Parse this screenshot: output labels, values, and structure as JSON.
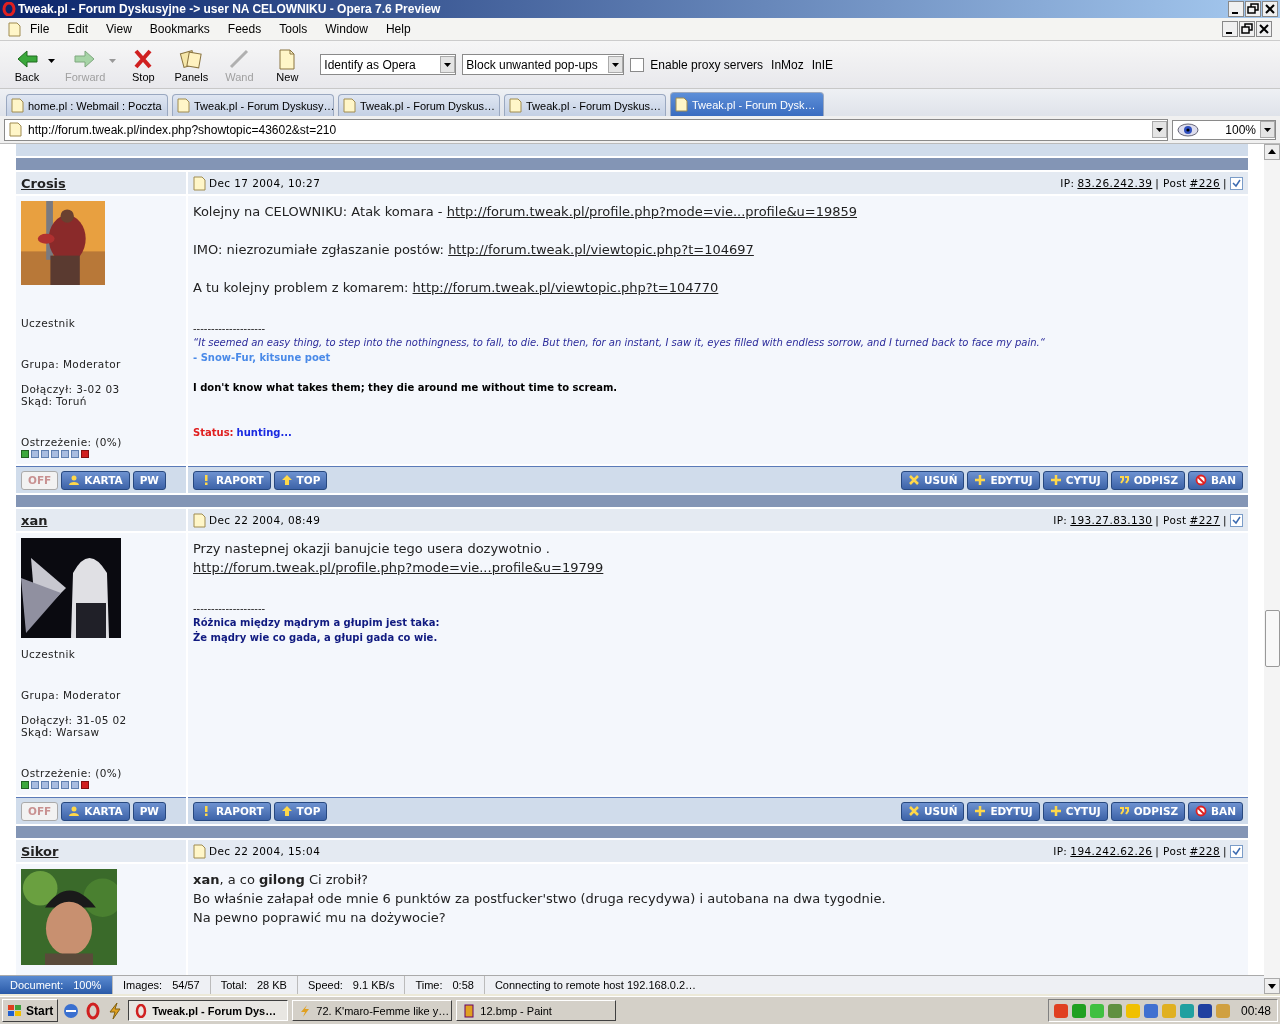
{
  "window": {
    "title": "Tweak.pl - Forum Dyskusyjne -> user NA CELOWNIKU - Opera 7.6 Preview"
  },
  "menu": [
    "File",
    "Edit",
    "View",
    "Bookmarks",
    "Feeds",
    "Tools",
    "Window",
    "Help"
  ],
  "toolbar": {
    "buttons": [
      {
        "label": "Back",
        "disabled": false,
        "caret": true
      },
      {
        "label": "Forward",
        "disabled": true,
        "caret": true
      },
      {
        "label": "Stop",
        "disabled": false,
        "caret": false
      },
      {
        "label": "Panels",
        "disabled": false,
        "caret": false
      },
      {
        "label": "Wand",
        "disabled": true,
        "caret": false
      },
      {
        "label": "New",
        "disabled": false,
        "caret": false
      }
    ],
    "dropdowns": [
      "Identify as Opera",
      "Block unwanted pop-ups"
    ],
    "proxy": {
      "label": "Enable proxy servers",
      "checked": false
    },
    "links": [
      "InMoz",
      "InIE"
    ]
  },
  "tabs": [
    {
      "label": "home.pl : Webmail : Poczta",
      "selected": false
    },
    {
      "label": "Tweak.pl - Forum Dyskusy…",
      "selected": false
    },
    {
      "label": "Tweak.pl - Forum Dyskus…",
      "selected": false
    },
    {
      "label": "Tweak.pl - Forum Dyskus…",
      "selected": false
    },
    {
      "label": "Tweak.pl - Forum Dysk…",
      "selected": true
    }
  ],
  "address": {
    "url": "http://forum.tweak.pl/index.php?showtopic=43602&st=210",
    "zoom": "100%"
  },
  "posts": [
    {
      "author": "Crosis",
      "date": "Dec 17 2004, 10:27",
      "ip_label": "IP:",
      "ip": "83.26.242.39",
      "post_label": "| Post",
      "post_number": "#226",
      "post_end": "|",
      "checked": true,
      "rank": "Uczestnik",
      "group": "Grupa: Moderator",
      "joined": "Dołączył: 3-02 03",
      "from": "Skąd: Toruń",
      "warning": "Ostrzeżenie: (0%)",
      "blocks": [
        {
          "kind": "para",
          "text": "Kolejny na CELOWNIKU: Atak komara - ",
          "link": "http://forum.tweak.pl/profile.php?mode=vie...profile&u=19859"
        },
        {
          "kind": "para",
          "text": "IMO: niezrozumiałe zgłaszanie postów: ",
          "link": "http://forum.tweak.pl/viewtopic.php?t=104697"
        },
        {
          "kind": "para",
          "text": "A tu kolejny problem z komarem: ",
          "link": "http://forum.tweak.pl/viewtopic.php?t=104770"
        },
        {
          "kind": "rule",
          "text": "--------------------"
        },
        {
          "kind": "quote",
          "text": "“It seemed an easy thing, to step into the nothingness, to fall, to die. But then, for an instant, I saw it, eyes filled with endless sorrow, and I turned back to face my pain.“"
        },
        {
          "kind": "attribution",
          "text": "- Snow-Fur, kitsune poet"
        },
        {
          "kind": "motto",
          "text": "I don't know what takes them; they die around me without time to scream."
        },
        {
          "kind": "status",
          "label": "Status:",
          "text": "hunting..."
        }
      ],
      "left_buttons": [
        {
          "label": "OFF",
          "kind": "status"
        },
        {
          "label": "KARTA",
          "kind": "action"
        },
        {
          "label": "PW",
          "kind": "action"
        }
      ],
      "mid_buttons": [
        "RAPORT",
        "TOP"
      ],
      "right_buttons": [
        "USUŃ",
        "EDYTUJ",
        "CYTUJ",
        "ODPISZ",
        "BAN"
      ]
    },
    {
      "author": "xan",
      "date": "Dec 22 2004, 08:49",
      "ip_label": "IP:",
      "ip": "193.27.83.130",
      "post_label": "| Post",
      "post_number": "#227",
      "post_end": "|",
      "checked": true,
      "rank": "Uczestnik",
      "group": "Grupa: Moderator",
      "joined": "Dołączył: 31-05 02",
      "from": "Skąd: Warsaw",
      "warning": "Ostrzeżenie: (0%)",
      "blocks": [
        {
          "kind": "line",
          "text": "Przy nastepnej okazji banujcie tego usera dozywotnio ."
        },
        {
          "kind": "line",
          "link": "http://forum.tweak.pl/profile.php?mode=vie...profile&u=19799"
        },
        {
          "kind": "rule",
          "text": "--------------------"
        },
        {
          "kind": "sig",
          "text": "Różnica między mądrym a głupim jest taka:"
        },
        {
          "kind": "sig",
          "text": "Że mądry wie co gada, a głupi gada co wie."
        }
      ],
      "left_buttons": [
        {
          "label": "OFF",
          "kind": "status"
        },
        {
          "label": "KARTA",
          "kind": "action"
        },
        {
          "label": "PW",
          "kind": "action"
        }
      ],
      "mid_buttons": [
        "RAPORT",
        "TOP"
      ],
      "right_buttons": [
        "USUŃ",
        "EDYTUJ",
        "CYTUJ",
        "ODPISZ",
        "BAN"
      ]
    },
    {
      "author": "Sikor",
      "date": "Dec 22 2004, 15:04",
      "ip_label": "IP:",
      "ip": "194.242.62.26",
      "post_label": "| Post",
      "post_number": "#228",
      "post_end": "|",
      "checked": true,
      "blocks": [
        {
          "kind": "line",
          "text": "**xan**, a co **gilong** Ci zrobił?"
        },
        {
          "kind": "line",
          "text": "Bo właśnie załapał ode mnie 6 punktów za postfucker'stwo (druga recydywa) i autobana na dwa tygodnie."
        },
        {
          "kind": "line",
          "text": "Na pewno poprawić mu na dożywocie?"
        }
      ]
    }
  ],
  "status_bar": {
    "fields": [
      {
        "label": "Document:",
        "value": "100%",
        "level": 1
      },
      {
        "label": "Images:",
        "value": "54/57"
      },
      {
        "label": "Total:",
        "value": "28 KB"
      },
      {
        "label": "Speed:",
        "value": "9.1 KB/s"
      },
      {
        "label": "Time:",
        "value": "0:58"
      }
    ],
    "message": "Connecting to remote host 192.168.0.2…"
  },
  "taskbar": {
    "start": "Start",
    "tasks": [
      {
        "label": "Tweak.pl - Forum Dys…",
        "selected": true
      },
      {
        "label": "72. K'maro-Femme like y…",
        "selected": false
      },
      {
        "label": "12.bmp - Paint",
        "selected": false
      }
    ],
    "clock": "00:48"
  }
}
